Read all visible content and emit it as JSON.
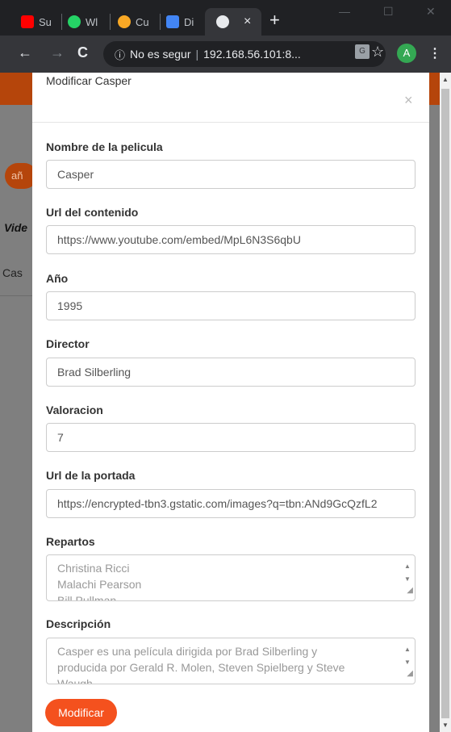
{
  "browser": {
    "tabs": [
      {
        "label": "Su",
        "color": "#ff0000"
      },
      {
        "label": "Wl",
        "color": "#25d366"
      },
      {
        "label": "Cu",
        "color": "#f9a825"
      },
      {
        "label": "Di",
        "color": "#4285f4"
      }
    ],
    "active_tab_close": "×",
    "new_tab": "+",
    "window_minimize": "—",
    "window_maximize": "☐",
    "window_close": "✕",
    "address_warning": "No es segur",
    "address_host": "192.168.56.101:8...",
    "avatar_letter": "A"
  },
  "background": {
    "pill_text": "añ",
    "column_header": "Vide",
    "cell_text": "Cas"
  },
  "modal": {
    "title": "Modificar Casper",
    "close": "×",
    "fields": {
      "nombre": {
        "label": "Nombre de la pelicula",
        "value": "Casper"
      },
      "url": {
        "label": "Url del contenido",
        "value": "https://www.youtube.com/embed/MpL6N3S6qbU"
      },
      "anio": {
        "label": "Año",
        "value": "1995"
      },
      "director": {
        "label": "Director",
        "value": "Brad Silberling"
      },
      "valoracion": {
        "label": "Valoracion",
        "value": "7"
      },
      "portada": {
        "label": "Url de la portada",
        "value": "https://encrypted-tbn3.gstatic.com/images?q=tbn:ANd9GcQzfL2"
      },
      "repartos": {
        "label": "Repartos",
        "line1": "Christina Ricci",
        "line2": "Malachi Pearson",
        "line3": "Bill Pullman"
      },
      "descripcion": {
        "label": "Descripción",
        "line1": "Casper es una película dirigida por Brad Silberling y",
        "line2": "producida por Gerald R. Molen, Steven Spielberg y Steve",
        "line3": "Waugh"
      }
    },
    "submit_label": "Modificar"
  },
  "colors": {
    "accent": "#f4511e",
    "banner": "#b5450b"
  }
}
